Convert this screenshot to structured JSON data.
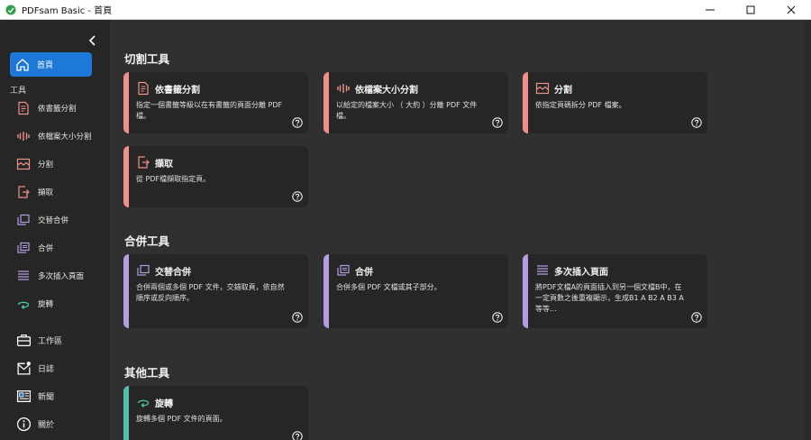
{
  "window": {
    "title": "PDFsam Basic - 首頁"
  },
  "colors": {
    "split": "#f0908a",
    "merge": "#b59de0",
    "other": "#4fc2ad",
    "accent": "#1e78d7",
    "icon_light": "#f0908a",
    "icon_purple": "#b59de0"
  },
  "sidebar": {
    "home_label": "首頁",
    "tools_header": "工具",
    "items": [
      {
        "label": "依書籤分割",
        "icon": "bookmark-split-icon"
      },
      {
        "label": "依檔案大小分割",
        "icon": "size-split-icon"
      },
      {
        "label": "分割",
        "icon": "split-icon"
      },
      {
        "label": "擷取",
        "icon": "extract-icon"
      },
      {
        "label": "交替合併",
        "icon": "alternate-mix-icon"
      },
      {
        "label": "合併",
        "icon": "merge-icon"
      },
      {
        "label": "多次插入頁面",
        "icon": "multi-insert-icon"
      },
      {
        "label": "旋轉",
        "icon": "rotate-icon"
      }
    ],
    "bottom_items": [
      {
        "label": "工作區",
        "icon": "briefcase-icon"
      },
      {
        "label": "日誌",
        "icon": "log-icon"
      },
      {
        "label": "新聞",
        "icon": "news-icon"
      },
      {
        "label": "關於",
        "icon": "info-icon"
      }
    ]
  },
  "main": {
    "sections": [
      {
        "title": "切割工具",
        "cards": [
          {
            "title": "依書籤分割",
            "desc": "指定一個書籤等級以在有書籤的頁面分離 PDF 檔。"
          },
          {
            "title": "依檔案大小分割",
            "desc": "以給定的檔案大小 （ 大約 ）分離 PDF 文件檔。"
          },
          {
            "title": "分割",
            "desc": "依指定頁碼拆分 PDF 檔案。"
          },
          {
            "title": "擷取",
            "desc": "從 PDF檔擷取指定頁。"
          }
        ]
      },
      {
        "title": "合併工具",
        "cards": [
          {
            "title": "交替合併",
            "desc": "合併兩個或多個 PDF 文件，交錯取頁，依自然順序或反向順序。"
          },
          {
            "title": "合併",
            "desc": "合併多個 PDF 文檔或其子部分。"
          },
          {
            "title": "多次插入頁面",
            "desc": "將PDF文檔A的頁面插入到另一個文檔B中，在一定頁數之後重複顯示，生成B1 A B2 A B3 A等等..."
          }
        ]
      },
      {
        "title": "其他工具",
        "cards": [
          {
            "title": "旋轉",
            "desc": "旋轉多個 PDF 文件的頁面。"
          }
        ]
      }
    ]
  }
}
